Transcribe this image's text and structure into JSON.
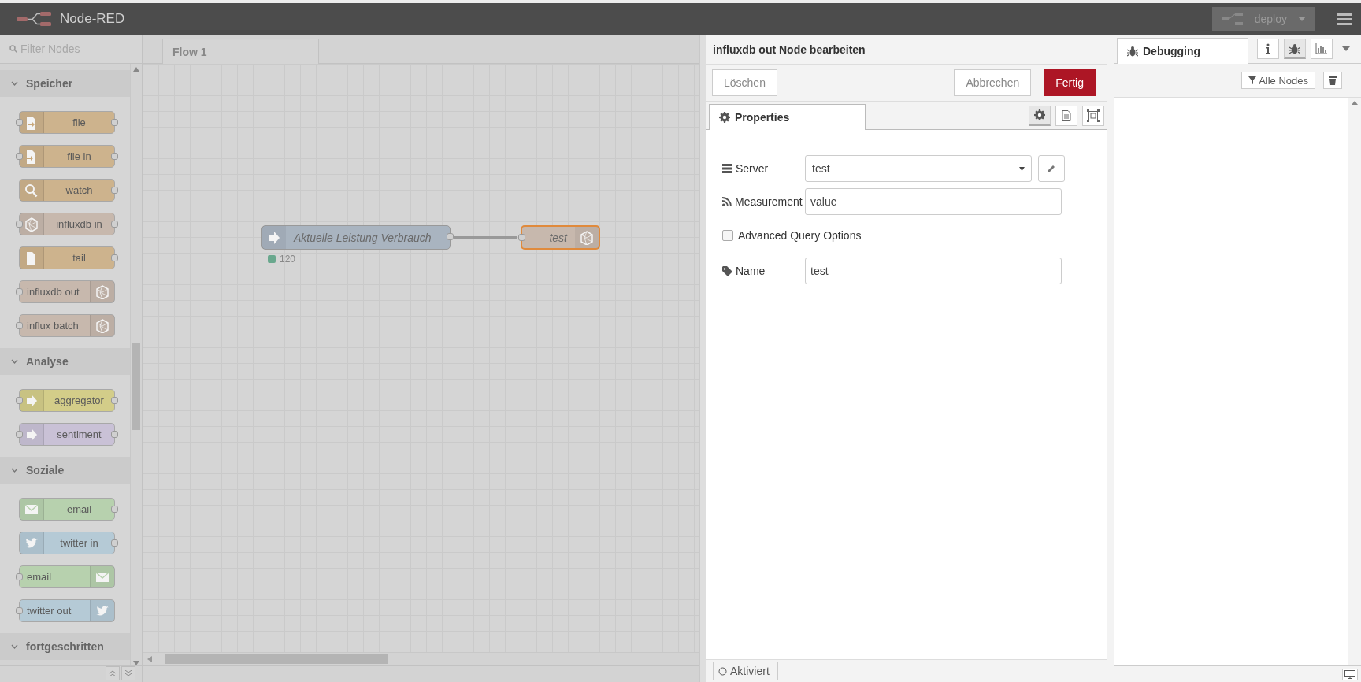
{
  "header": {
    "title": "Node-RED",
    "deploy": {
      "label": "deploy",
      "disabled": true
    }
  },
  "palette": {
    "filter": {
      "placeholder": "Filter Nodes"
    },
    "categories": [
      {
        "name": "Speicher",
        "expanded": true,
        "nodes": [
          {
            "label": "file",
            "kind": "file",
            "color": "#cdb38d",
            "inputs": true,
            "outputs": true
          },
          {
            "label": "file in",
            "kind": "file-in",
            "color": "#cdb38d",
            "inputs": true,
            "outputs": true
          },
          {
            "label": "watch",
            "kind": "watch",
            "color": "#cdb38d",
            "inputs": false,
            "outputs": true
          },
          {
            "label": "influxdb in",
            "kind": "influxdb",
            "color": "#c7b8ad",
            "inputs": true,
            "outputs": true
          },
          {
            "label": "tail",
            "kind": "tail",
            "color": "#cdb38d",
            "inputs": false,
            "outputs": true
          },
          {
            "label": "influxdb out",
            "kind": "influxdb",
            "color": "#c7b8ad",
            "inputs": true,
            "outputs": false
          },
          {
            "label": "influx batch",
            "kind": "influxdb",
            "color": "#c7b8ad",
            "inputs": true,
            "outputs": false
          }
        ]
      },
      {
        "name": "Analyse",
        "expanded": true,
        "nodes": [
          {
            "label": "aggregator",
            "kind": "function",
            "color": "#d3cd89",
            "inputs": true,
            "outputs": true
          },
          {
            "label": "sentiment",
            "kind": "function",
            "color": "#c9c1d6",
            "inputs": true,
            "outputs": true
          }
        ]
      },
      {
        "name": "Soziale",
        "expanded": true,
        "nodes": [
          {
            "label": "email",
            "kind": "email",
            "color": "#b7d1ae",
            "inputs": false,
            "outputs": true
          },
          {
            "label": "twitter in",
            "kind": "twitter",
            "color": "#b5cad6",
            "inputs": false,
            "outputs": true
          },
          {
            "label": "email",
            "kind": "email",
            "color": "#b7d1ae",
            "inputs": true,
            "outputs": false
          },
          {
            "label": "twitter out",
            "kind": "twitter",
            "color": "#b5cad6",
            "inputs": true,
            "outputs": false
          }
        ]
      },
      {
        "name": "fortgeschritten",
        "expanded": true
      }
    ]
  },
  "workspace": {
    "tabs": [
      {
        "label": "Flow 1",
        "selected": true
      }
    ],
    "nodes": [
      {
        "label": "Aktuelle Leistung Verbrauch",
        "kind": "inject",
        "color": "#a9b4c0",
        "selected": false,
        "status": {
          "text": "120",
          "color": "#6aa88e"
        }
      },
      {
        "label": "test",
        "kind": "influxdb",
        "color": "#c7b8ad",
        "selected": true
      }
    ]
  },
  "editor": {
    "title": "influxdb out Node bearbeiten",
    "buttons": [
      {
        "label": "Löschen",
        "kind": "plain"
      },
      {
        "label": "Abbrechen",
        "kind": "plain"
      },
      {
        "label": "Fertig",
        "kind": "primary"
      }
    ],
    "tabs": [
      {
        "label": "Properties",
        "selected": true
      }
    ],
    "tab_buttons": [
      {
        "kind": "settings",
        "selected": true
      },
      {
        "kind": "description",
        "selected": false
      },
      {
        "kind": "appearance",
        "selected": false
      }
    ],
    "fields": [
      {
        "kind": "select",
        "label": "Server",
        "value": "test"
      },
      {
        "kind": "input",
        "label": "Measurement",
        "value": "value"
      },
      {
        "kind": "checkbox",
        "label": "Advanced Query Options",
        "checked": false
      },
      {
        "kind": "input",
        "label": "Name",
        "value": "test"
      }
    ],
    "footer": {
      "label": "Aktiviert"
    }
  },
  "sidebar": {
    "tabs": [
      {
        "label": "Debugging",
        "selected": true
      }
    ],
    "tab_buttons": [
      {
        "kind": "info",
        "selected": false
      },
      {
        "kind": "debug",
        "selected": true
      },
      {
        "kind": "chart",
        "selected": false
      }
    ],
    "filter": {
      "label": "Alle Nodes"
    }
  }
}
